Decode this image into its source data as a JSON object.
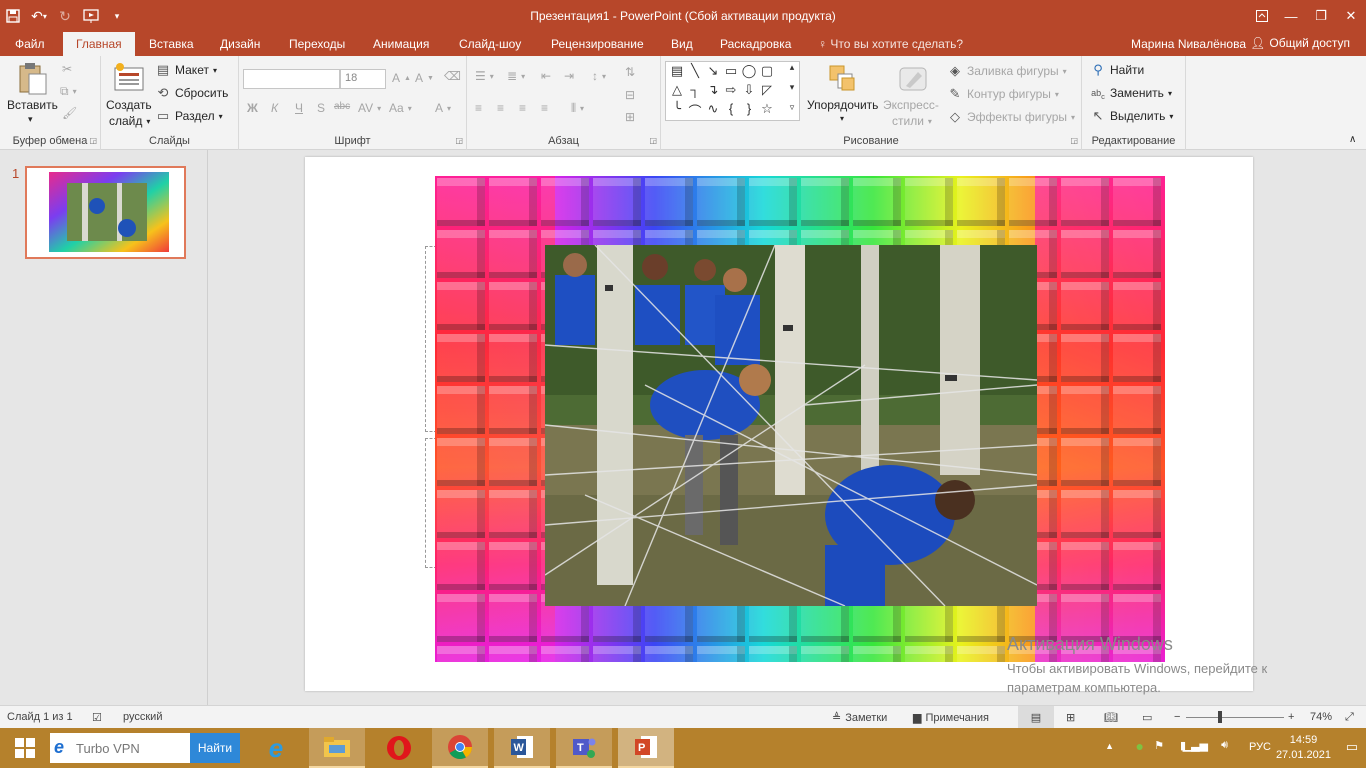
{
  "app": {
    "window_title": "Презентация1 - PowerPoint (Сбой активации продукта)",
    "user_name": "Марина Nивалёнова",
    "share_label": "Общий доступ"
  },
  "tabs": [
    {
      "label": "Файл"
    },
    {
      "label": "Главная"
    },
    {
      "label": "Вставка"
    },
    {
      "label": "Дизайн"
    },
    {
      "label": "Переходы"
    },
    {
      "label": "Анимация"
    },
    {
      "label": "Слайд-шоу"
    },
    {
      "label": "Рецензирование"
    },
    {
      "label": "Вид"
    },
    {
      "label": "Раскадровка"
    }
  ],
  "tell_me": "Что вы хотите сделать?",
  "ribbon": {
    "clipboard": {
      "label": "Буфер обмена",
      "paste": "Вставить"
    },
    "slides": {
      "label": "Слайды",
      "new_slide_1": "Создать",
      "new_slide_2": "слайд",
      "layout": "Макет",
      "reset": "Сбросить",
      "section": "Раздел"
    },
    "font": {
      "label": "Шрифт",
      "font_name": "",
      "font_size": "18",
      "bold": "Ж",
      "italic": "К",
      "underline": "Ч",
      "shadow": "S",
      "strike": "abc",
      "spacing": "AV",
      "case": "Aa",
      "color": "A"
    },
    "paragraph": {
      "label": "Абзац"
    },
    "drawing": {
      "label": "Рисование",
      "arrange": "Упорядочить",
      "quick_styles_1": "Экспресс-",
      "quick_styles_2": "стили",
      "fill": "Заливка фигуры",
      "outline": "Контур фигуры",
      "effects": "Эффекты фигуры"
    },
    "editing": {
      "label": "Редактирование",
      "find": "Найти",
      "replace": "Заменить",
      "select": "Выделить"
    }
  },
  "thumbnails": [
    {
      "number": "1"
    }
  ],
  "watermark": {
    "line1": "Активация Windows",
    "line2": "Чтобы активировать Windows, перейдите к",
    "line3": "параметрам компьютера."
  },
  "statusbar": {
    "slide_info": "Слайд 1 из 1",
    "language": "русский",
    "notes": "Заметки",
    "comments": "Примечания",
    "zoom": "74%"
  },
  "taskbar": {
    "search_text": "Turbo VPN",
    "search_button": "Найти",
    "lang": "РУС",
    "time": "14:59",
    "date": "27.01.2021"
  },
  "colors": {
    "accent": "#b7472a",
    "ribbon_bg": "#f3f3f3",
    "taskbar": "#b5812c"
  }
}
